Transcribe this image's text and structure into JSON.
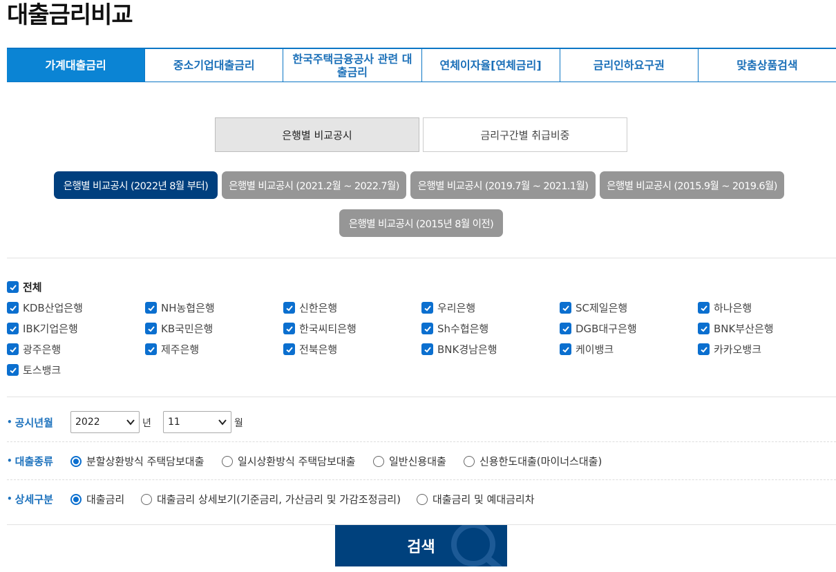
{
  "page_title": "대출금리비교",
  "tabs": [
    {
      "label": "가계대출금리"
    },
    {
      "label": "중소기업대출금리"
    },
    {
      "label": "한국주택금융공사 관련 대출금리"
    },
    {
      "label": "연체이자율[연체금리]"
    },
    {
      "label": "금리인하요구권"
    },
    {
      "label": "맞춤상품검색"
    }
  ],
  "segments": [
    {
      "label": "은행별 비교공시"
    },
    {
      "label": "금리구간별 취급비중"
    }
  ],
  "periods": [
    {
      "label": "은행별 비교공시 (2022년 8월 부터)"
    },
    {
      "label": "은행별 비교공시 (2021.2월 ~ 2022.7월)"
    },
    {
      "label": "은행별 비교공시 (2019.7월 ~ 2021.1월)"
    },
    {
      "label": "은행별 비교공시 (2015.9월 ~ 2019.6월)"
    },
    {
      "label": "은행별 비교공시 (2015년 8월 이전)"
    }
  ],
  "banks": {
    "all_label": "전체",
    "items": [
      {
        "label": "KDB산업은행"
      },
      {
        "label": "NH농협은행"
      },
      {
        "label": "신한은행"
      },
      {
        "label": "우리은행"
      },
      {
        "label": "SC제일은행"
      },
      {
        "label": "하나은행"
      },
      {
        "label": "IBK기업은행"
      },
      {
        "label": "KB국민은행"
      },
      {
        "label": "한국씨티은행"
      },
      {
        "label": "Sh수협은행"
      },
      {
        "label": "DGB대구은행"
      },
      {
        "label": "BNK부산은행"
      },
      {
        "label": "광주은행"
      },
      {
        "label": "제주은행"
      },
      {
        "label": "전북은행"
      },
      {
        "label": "BNK경남은행"
      },
      {
        "label": "케이뱅크"
      },
      {
        "label": "카카오뱅크"
      },
      {
        "label": "토스뱅크"
      }
    ]
  },
  "filters": {
    "period_label": "공시년월",
    "year_value": "2022",
    "year_unit": "년",
    "month_value": "11",
    "month_unit": "월",
    "loan_type_label": "대출종류",
    "loan_types": [
      {
        "label": "분할상환방식 주택담보대출"
      },
      {
        "label": "일시상환방식 주택담보대출"
      },
      {
        "label": "일반신용대출"
      },
      {
        "label": "신용한도대출(마이너스대출)"
      }
    ],
    "detail_label": "상세구분",
    "details": [
      {
        "label": "대출금리"
      },
      {
        "label": "대출금리 상세보기(기준금리, 가산금리 및 가감조정금리)"
      },
      {
        "label": "대출금리 및 예대금리차"
      }
    ]
  },
  "search_label": "검색",
  "colors": {
    "accent": "#0b84d4",
    "navy": "#00417d",
    "tab_border": "#0b76c5",
    "pill_gray": "#969696"
  }
}
